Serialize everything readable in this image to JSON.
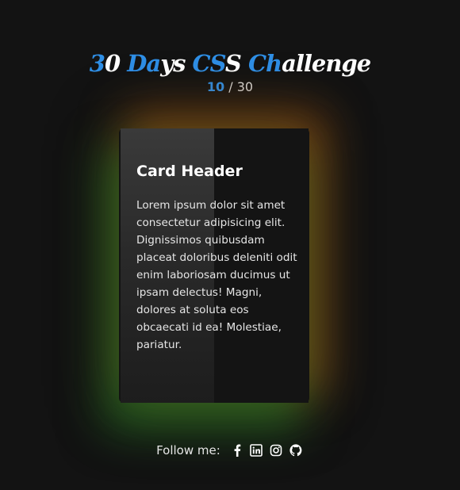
{
  "header": {
    "title_parts": [
      "3",
      "0 ",
      "Da",
      "ys ",
      "CS",
      "S ",
      "Ch",
      "allenge"
    ],
    "counter_current": "10",
    "counter_separator": "/",
    "counter_total": "30"
  },
  "card": {
    "header": "Card Header",
    "body": "Lorem ipsum dolor sit amet consectetur adipisicing elit. Dignissimos quibusdam placeat doloribus deleniti odit enim laboriosam ducimus ut ipsam delectus! Magni, dolores at soluta eos obcaecati id ea! Molestiae, pariatur."
  },
  "footer": {
    "label": "Follow me:",
    "icons": [
      "facebook-icon",
      "linkedin-icon",
      "instagram-icon",
      "github-icon"
    ]
  },
  "colors": {
    "background": "#131313",
    "accent": "#2f8fe6",
    "glow_green": "#228228",
    "glow_orange": "#be5f14"
  }
}
